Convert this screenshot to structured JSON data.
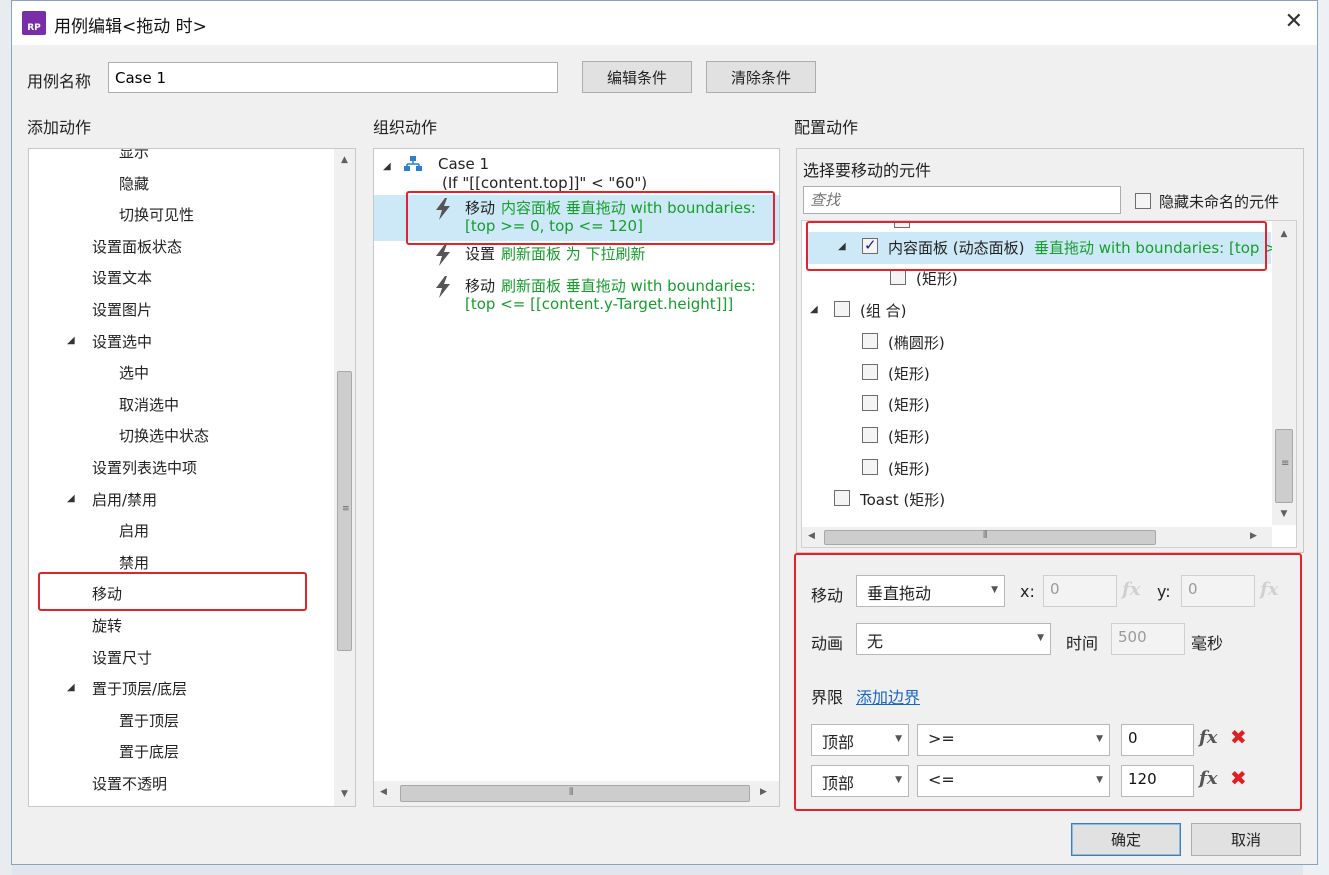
{
  "window": {
    "title": "用例编辑<拖动 时>",
    "icon_text": "RP"
  },
  "case_name": {
    "label": "用例名称",
    "value": "Case 1"
  },
  "buttons": {
    "edit_condition": "编辑条件",
    "clear_condition": "清除条件",
    "ok": "确定",
    "cancel": "取消"
  },
  "sections": {
    "add_action": "添加动作",
    "organize_action": "组织动作",
    "configure_action": "配置动作"
  },
  "add_actions": [
    {
      "label": "显示",
      "level": 2
    },
    {
      "label": "隐藏",
      "level": 2
    },
    {
      "label": "切换可见性",
      "level": 2
    },
    {
      "label": "设置面板状态",
      "level": 1
    },
    {
      "label": "设置文本",
      "level": 1
    },
    {
      "label": "设置图片",
      "level": 1
    },
    {
      "label": "设置选中",
      "level": 1,
      "expanded": true
    },
    {
      "label": "选中",
      "level": 2
    },
    {
      "label": "取消选中",
      "level": 2
    },
    {
      "label": "切换选中状态",
      "level": 2
    },
    {
      "label": "设置列表选中项",
      "level": 1
    },
    {
      "label": "启用/禁用",
      "level": 1,
      "expanded": true
    },
    {
      "label": "启用",
      "level": 2
    },
    {
      "label": "禁用",
      "level": 2
    },
    {
      "label": "移动",
      "level": 1,
      "highlighted": true
    },
    {
      "label": "旋转",
      "level": 1
    },
    {
      "label": "设置尺寸",
      "level": 1
    },
    {
      "label": "置于顶层/底层",
      "level": 1,
      "expanded": true
    },
    {
      "label": "置于顶层",
      "level": 2
    },
    {
      "label": "置于底层",
      "level": 2
    },
    {
      "label": "设置不透明",
      "level": 1
    }
  ],
  "organize": {
    "case_title": "Case 1",
    "case_condition": "(If \"[[content.top]]\" < \"60\")",
    "actions": [
      {
        "verb": "移动",
        "detail": "内容面板 垂直拖动 with boundaries:",
        "detail2": "[top >= 0, top <= 120]",
        "selected": true
      },
      {
        "verb": "设置",
        "detail": "刷新面板 为 下拉刷新",
        "detail2": ""
      },
      {
        "verb": "移动",
        "detail": "刷新面板 垂直拖动 with boundaries:",
        "detail2": "[top <= [[content.y-Target.height]]]"
      }
    ]
  },
  "configure": {
    "select_label": "选择要移动的元件",
    "search_placeholder": "查找",
    "hide_unnamed": "隐藏未命名的元件",
    "tree": [
      {
        "name": "内容面板 (动态面板)",
        "extra": "垂直拖动 with boundaries: [top >=",
        "checked": true,
        "level": 1,
        "expand": true,
        "selected": true
      },
      {
        "name": "(矩形)",
        "level": 2
      },
      {
        "name": "(组 合)",
        "level": 0,
        "expand": true
      },
      {
        "name": "(椭圆形)",
        "level": 1
      },
      {
        "name": "(矩形)",
        "level": 1
      },
      {
        "name": "(矩形)",
        "level": 1
      },
      {
        "name": "(矩形)",
        "level": 1
      },
      {
        "name": "(矩形)",
        "level": 1
      },
      {
        "name": "Toast (矩形)",
        "level": 0
      }
    ],
    "move_label": "移动",
    "move_type": "垂直拖动",
    "x_label": "x:",
    "x_value": "0",
    "y_label": "y:",
    "y_value": "0",
    "fx": "fx",
    "anim_label": "动画",
    "anim_value": "无",
    "time_label": "时间",
    "time_value": "500",
    "time_unit": "毫秒",
    "bound_label": "界限",
    "add_bound": "添加边界",
    "bounds": [
      {
        "edge": "顶部",
        "op": ">=",
        "value": "0"
      },
      {
        "edge": "顶部",
        "op": "<=",
        "value": "120"
      }
    ]
  }
}
